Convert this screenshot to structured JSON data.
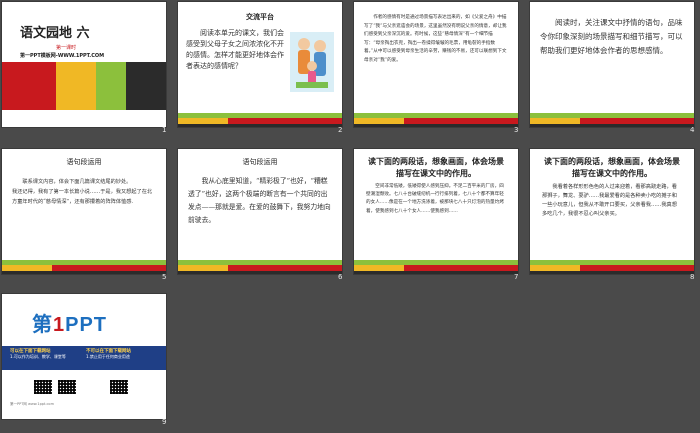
{
  "slides": [
    {
      "number": "1",
      "title": "语文园地 六",
      "subtitle": "第一课时",
      "footer": "第一PPT模板网-WWW.1PPT.COM"
    },
    {
      "number": "2",
      "title": "交流平台",
      "body": "阅读本单元的课文，我们会感受到父母子女之间浓浓化不开的感情。怎样才能更好地体会作者表达的感情呢？"
    },
    {
      "number": "3",
      "body": "作者的感情有时是通过场景描写表达出来的，如《父爱之舟》中描写了“我”与父亲逛庙会的场景，这里虽然没有明说父亲的情意，却让我们感受到父亲深沉的爱。有时候，这些“慈母情深”有一个细节描写：“母亲掏出衣兜，掏出一卷揉得皱皱的毛票，用龟裂的手指数着。”从中可以感受到母亲生活的辛劳，赚钱的不易，还可以联想到下文母亲对“我”的爱。"
    },
    {
      "number": "4",
      "body": "阅读时，关注课文中抒情的语句，品味令你印象深刻的场景描写和细节描写，可以帮助我们更好地体会作者的思想感情。"
    },
    {
      "number": "5",
      "title": "语句段运用",
      "body": "联系课文内容，体会下面几篇课文结尾的妙处。\n我还记得，我有了第一本长篇小说……于是，我又想起了在北方童年时代的“慈母情深”，还有那攥着的阵阵体恤感."
    },
    {
      "number": "6",
      "title": "语句段运用",
      "body": "我从心底里知道，“精彩极了”也好，“糟糕透了”也好，这两个极端的断言有一个共同的出发点——那就是爱。在爱的鼓舞下，我努力地向前驶去。"
    },
    {
      "number": "7",
      "heading": "读下面的两段话，想象画面，体会场景描写在课文中的作用。",
      "body": "空间非常低矮，低矮得使人感到压抑。不足二百平米的厂房，四壁潮湿颓败。七八十台破缝纫机一行行排列着，七八十个都不算年轻的女人……像是在一个地方洗涤着，被那块七八十只灯泡的热量灼烤着，使我感到七八十个女人……使我感到……"
    },
    {
      "number": "8",
      "heading": "读下面的两段话，想象画面，体会场景描写在课文中的作用。",
      "body": "我看着各样形形色色的人过来迎着，看那高跷走路，看那狮子，舞龙、耍驴……我最爱看的是各种卖小吃的摊子和一些小玩意儿，但我从不敢开口要买，父亲看我……我真想多吃几个，我很不忍心叫父亲买。"
    },
    {
      "number": "9",
      "logo_first": "第",
      "logo_one": "1",
      "logo_rest": "PPT",
      "band_left_title": "可以在下面下载网站",
      "band_right_title": "不可以在下面下载网站",
      "band_left_text": "1.可以作为培训、教学、课堂等",
      "band_right_text": "1.禁止用于任何商业用途",
      "small_text": "第一PPT网 www.1ppt.com"
    }
  ]
}
